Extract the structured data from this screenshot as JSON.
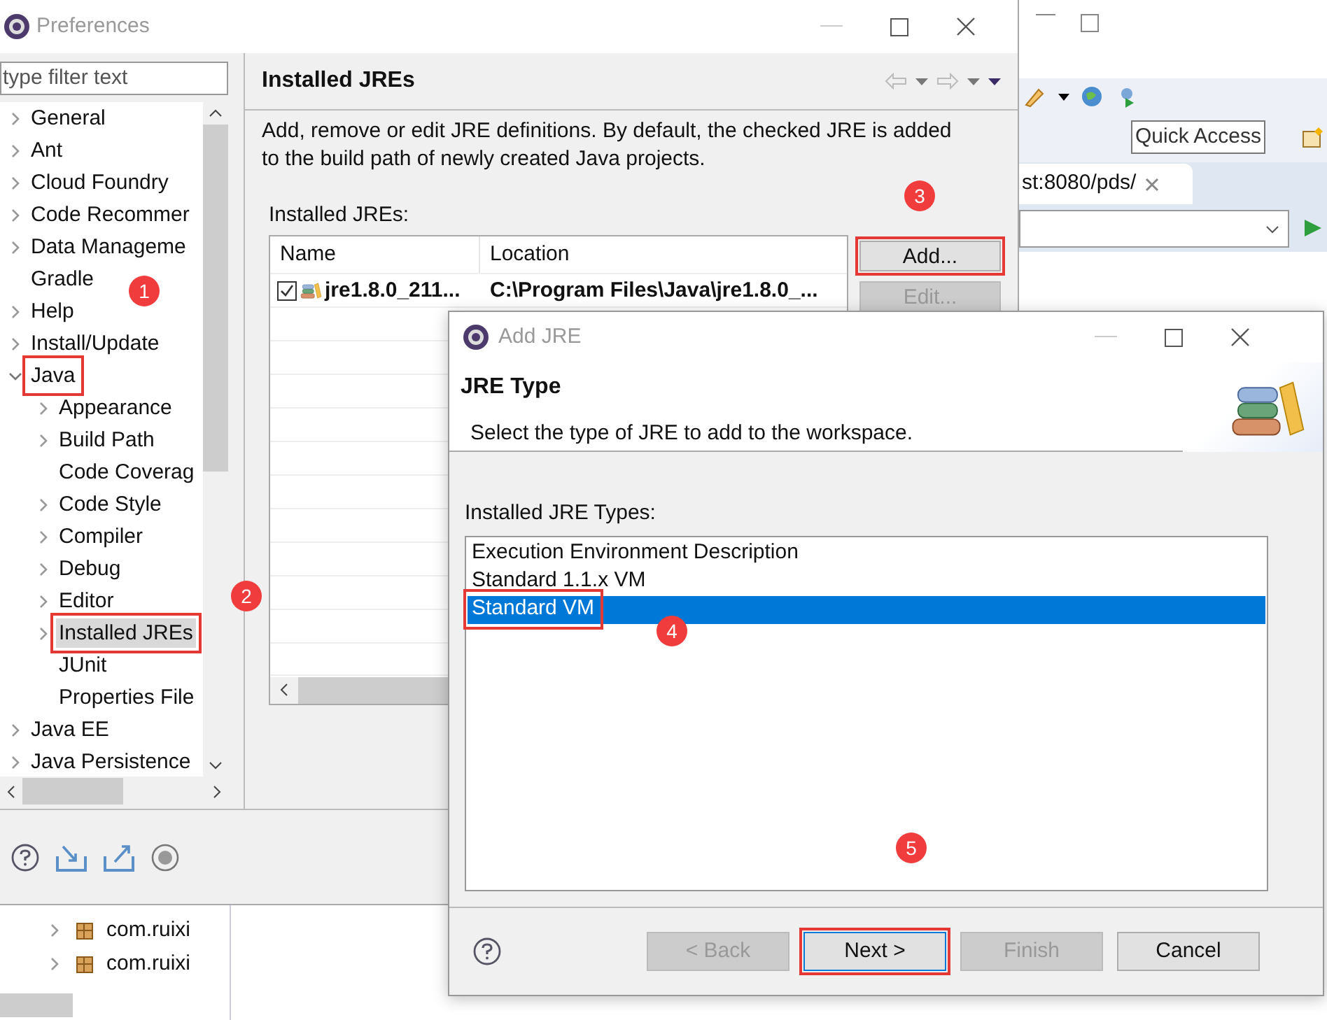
{
  "ide": {
    "quick_access": "Quick Access",
    "editor_tab": "st:8080/pds/",
    "packages": [
      {
        "label": "com.ruixi"
      },
      {
        "label": "com.ruixi"
      }
    ]
  },
  "preferences": {
    "title": "Preferences",
    "filter_placeholder": "type filter text",
    "tree": [
      {
        "label": "General",
        "expanded": false,
        "selected": false,
        "highlighted": false
      },
      {
        "label": "Ant",
        "expanded": false,
        "selected": false,
        "highlighted": false
      },
      {
        "label": "Cloud Foundry",
        "expanded": false,
        "selected": false,
        "highlighted": false
      },
      {
        "label": "Code Recommer",
        "expanded": false,
        "selected": false,
        "highlighted": false
      },
      {
        "label": "Data Manageme",
        "expanded": false,
        "selected": false,
        "highlighted": false
      },
      {
        "label": "Gradle",
        "selected": false,
        "highlighted": false
      },
      {
        "label": "Help",
        "expanded": false,
        "selected": false,
        "highlighted": false
      },
      {
        "label": "Install/Update",
        "expanded": false,
        "selected": false,
        "highlighted": false
      },
      {
        "label": "Java",
        "expanded": true,
        "selected": false,
        "highlighted": true,
        "children": [
          {
            "label": "Appearance",
            "expanded": false,
            "selected": false,
            "highlighted": false
          },
          {
            "label": "Build Path",
            "expanded": false,
            "selected": false,
            "highlighted": false
          },
          {
            "label": "Code Coverag",
            "selected": false,
            "highlighted": false
          },
          {
            "label": "Code Style",
            "expanded": false,
            "selected": false,
            "highlighted": false
          },
          {
            "label": "Compiler",
            "expanded": false,
            "selected": false,
            "highlighted": false
          },
          {
            "label": "Debug",
            "expanded": false,
            "selected": false,
            "highlighted": false
          },
          {
            "label": "Editor",
            "expanded": false,
            "selected": false,
            "highlighted": false
          },
          {
            "label": "Installed JREs",
            "expanded": false,
            "selected": true,
            "highlighted": true
          },
          {
            "label": "JUnit",
            "selected": false,
            "highlighted": false
          },
          {
            "label": "Properties File",
            "selected": false,
            "highlighted": false
          }
        ]
      },
      {
        "label": "Java EE",
        "expanded": false,
        "selected": false,
        "highlighted": false
      },
      {
        "label": "Java Persistence",
        "expanded": false,
        "selected": false,
        "highlighted": false
      }
    ],
    "page_title": "Installed JREs",
    "description": "Add, remove or edit JRE definitions. By default, the checked JRE is added to the build path of newly created Java projects.",
    "table_label": "Installed JREs:",
    "columns": [
      "Name",
      "Location"
    ],
    "rows": [
      {
        "name": "jre1.8.0_211...",
        "location": "C:\\Program Files\\Java\\jre1.8.0_...",
        "checked": true
      }
    ],
    "buttons": [
      {
        "label": "Add...",
        "disabled": false,
        "highlighted": true
      },
      {
        "label": "Edit...",
        "disabled": true,
        "highlighted": false
      }
    ]
  },
  "dialog": {
    "title": "Add JRE",
    "heading": "JRE Type",
    "description": "Select the type of JRE to add to the workspace.",
    "list_label": "Installed JRE Types:",
    "types": [
      {
        "label": "Execution Environment Description",
        "selected": false,
        "highlighted": false
      },
      {
        "label": "Standard 1.1.x VM",
        "selected": false,
        "highlighted": false
      },
      {
        "label": "Standard VM",
        "selected": true,
        "highlighted": true
      }
    ],
    "buttons": [
      {
        "label": "< Back",
        "disabled": true,
        "highlighted": false,
        "focused": false
      },
      {
        "label": "Next >",
        "disabled": false,
        "highlighted": true,
        "focused": true
      },
      {
        "label": "Finish",
        "disabled": true,
        "highlighted": false,
        "focused": false
      },
      {
        "label": "Cancel",
        "disabled": false,
        "highlighted": false,
        "focused": false
      }
    ]
  },
  "markers": [
    {
      "label": "1"
    },
    {
      "label": "2"
    },
    {
      "label": "3"
    },
    {
      "label": "4"
    },
    {
      "label": "5"
    }
  ]
}
